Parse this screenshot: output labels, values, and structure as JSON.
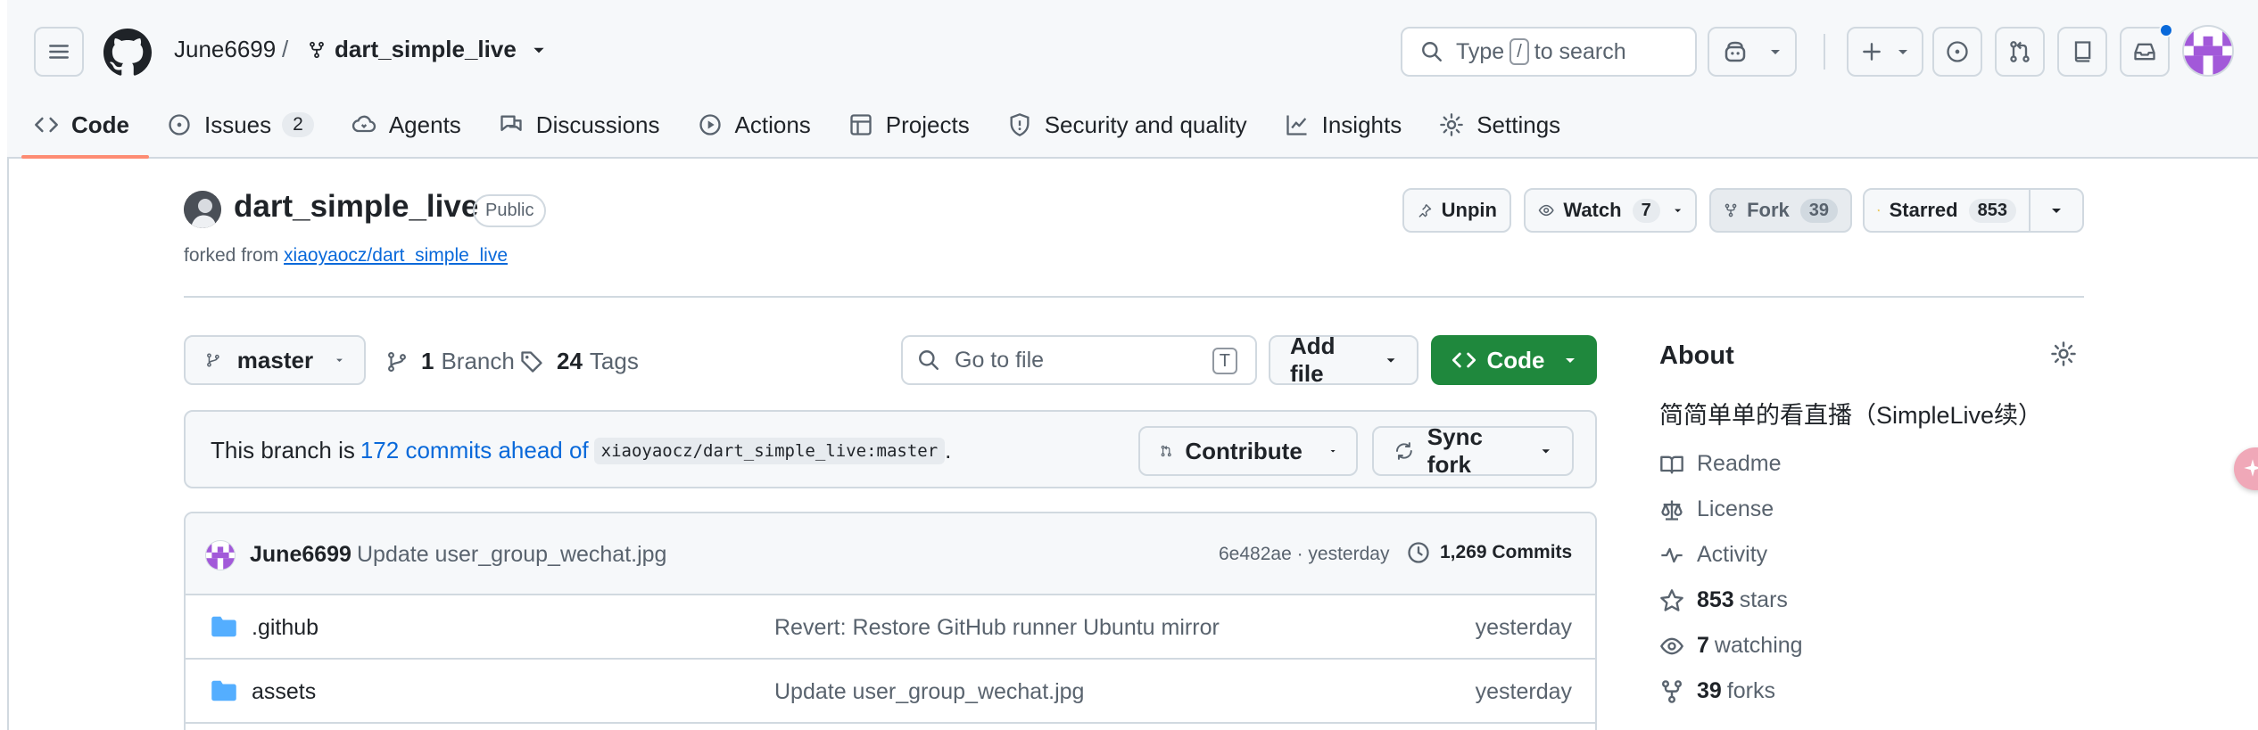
{
  "header": {
    "owner": "June6699",
    "separator": "/",
    "repo": "dart_simple_live",
    "search_prefix": "Type",
    "search_key": "/",
    "search_suffix": "to search"
  },
  "nav": [
    {
      "label": "Code",
      "icon": "code-icon",
      "active": true
    },
    {
      "label": "Issues",
      "icon": "issue-opened-icon",
      "count": "2"
    },
    {
      "label": "Agents",
      "icon": "agent-icon"
    },
    {
      "label": "Discussions",
      "icon": "comment-discussion-icon"
    },
    {
      "label": "Actions",
      "icon": "play-icon"
    },
    {
      "label": "Projects",
      "icon": "table-icon"
    },
    {
      "label": "Security and quality",
      "icon": "shield-icon"
    },
    {
      "label": "Insights",
      "icon": "graph-icon"
    },
    {
      "label": "Settings",
      "icon": "gear-icon"
    }
  ],
  "repo": {
    "name": "dart_simple_live",
    "visibility": "Public",
    "forked_from_prefix": "forked from",
    "forked_from": "xiaoyaocz/dart_simple_live"
  },
  "actions": {
    "unpin": "Unpin",
    "watch": "Watch",
    "watch_count": "7",
    "fork": "Fork",
    "fork_count": "39",
    "starred": "Starred",
    "star_count": "853"
  },
  "branch_bar": {
    "branch": "master",
    "branches_count": "1",
    "branches_label": "Branch",
    "tags_count": "24",
    "tags_label": "Tags",
    "goto_placeholder": "Go to file",
    "goto_key": "T",
    "add_file": "Add file",
    "code": "Code"
  },
  "ahead": {
    "prefix": "This branch is",
    "link": "172 commits ahead of",
    "ref": "xiaoyaocz/dart_simple_live:master",
    "suffix": ".",
    "contribute": "Contribute",
    "sync": "Sync fork"
  },
  "latest_commit": {
    "author": "June6699",
    "message": "Update user_group_wechat.jpg",
    "hash_time": "6e482ae · yesterday",
    "commits": "1,269 Commits"
  },
  "files": [
    {
      "name": ".github",
      "message": "Revert: Restore GitHub runner Ubuntu mirror",
      "date": "yesterday"
    },
    {
      "name": "assets",
      "message": "Update user_group_wechat.jpg",
      "date": "yesterday"
    }
  ],
  "about": {
    "heading": "About",
    "description": "简简单单的看直播（SimpleLive续）",
    "readme": "Readme",
    "license": "License",
    "activity": "Activity",
    "stars_count": "853",
    "stars_label": "stars",
    "watching_count": "7",
    "watching_label": "watching",
    "forks_count": "39",
    "forks_label": "forks"
  },
  "colors": {
    "accent_blue": "#0969da",
    "code_green": "#1f883d",
    "active_underline": "#fd8c73",
    "folder_blue": "#54aeff"
  }
}
